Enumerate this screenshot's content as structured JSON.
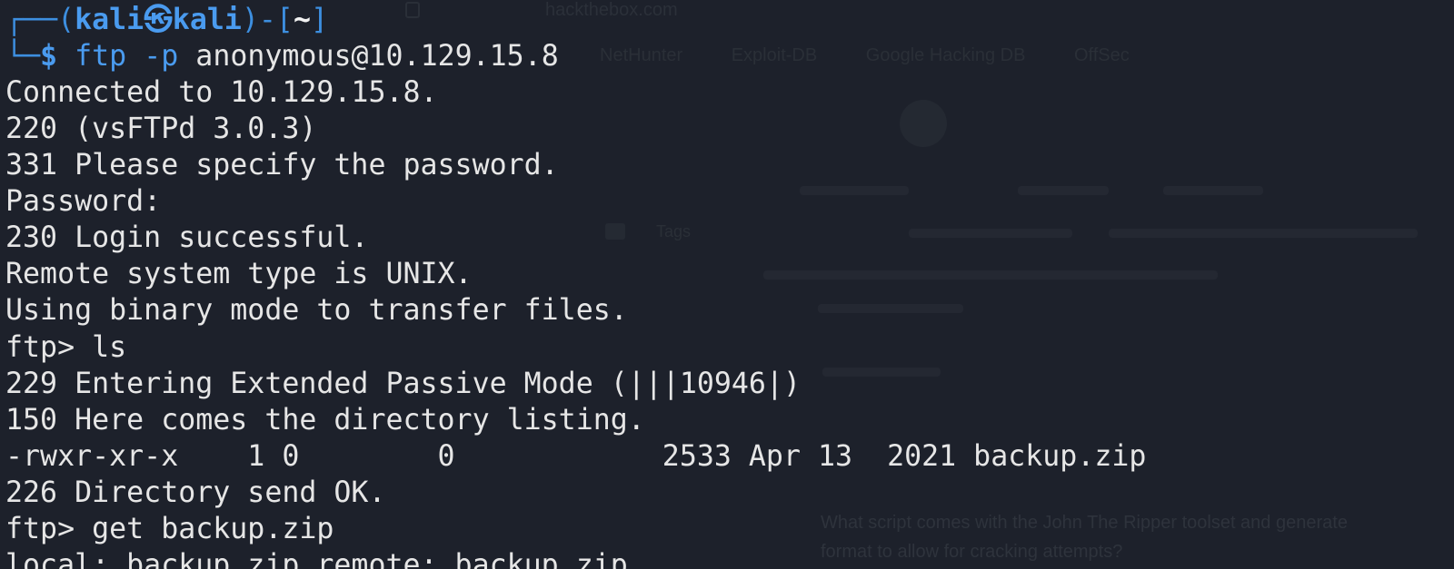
{
  "background": {
    "url": "hackthebox.com",
    "bookmarks": [
      "NetHunter",
      "Exploit-DB",
      "Google Hacking DB",
      "OffSec"
    ],
    "tags_label": "Tags",
    "question_line1": "What script comes with the John The Ripper toolset and generate",
    "question_line2": "format to allow for cracking attempts?"
  },
  "prompt": {
    "open": "┌──(",
    "user": "kali",
    "sep": "㉿",
    "host": "kali",
    "mid": ")-[",
    "cwd": "~",
    "close": "]",
    "corner": "└─",
    "dollar": "$",
    "command": "ftp",
    "flag": "-p",
    "argument": "anonymous@10.129.15.8"
  },
  "output_lines": [
    "Connected to 10.129.15.8.",
    "220 (vsFTPd 3.0.3)",
    "331 Please specify the password.",
    "Password:",
    "230 Login successful.",
    "Remote system type is UNIX.",
    "Using binary mode to transfer files.",
    "ftp> ls",
    "229 Entering Extended Passive Mode (|||10946|)",
    "150 Here comes the directory listing.",
    "-rwxr-xr-x    1 0        0            2533 Apr 13  2021 backup.zip",
    "226 Directory send OK.",
    "ftp> get backup.zip"
  ],
  "cut_line": "local: backup.zip remote: backup.zip",
  "colors": {
    "terminal_bg": "#1d212b",
    "prompt_blue": "#4a9bef",
    "text": "#e6e6e6"
  }
}
